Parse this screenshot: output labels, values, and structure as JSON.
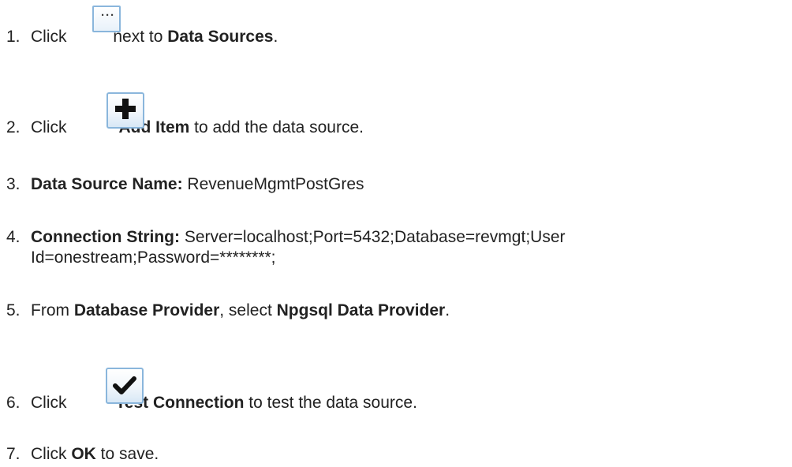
{
  "steps": [
    {
      "num": "1.",
      "pre": "Click",
      "post": " next to ",
      "bold": "Data Sources",
      "end": "."
    },
    {
      "num": "2.",
      "pre": "Click",
      "bold": "Add Item",
      "post": " to add the data source."
    },
    {
      "num": "3.",
      "bold": "Data Source Name:",
      "value": " RevenueMgmtPostGres"
    },
    {
      "num": "4.",
      "bold": "Connection String:",
      "value": " Server=localhost;Port=5432;Database=revmgt;User",
      "value_line2": "Id=onestream;Password=********;"
    },
    {
      "num": "5.",
      "pre": "From ",
      "bold": "Database Provider",
      "mid": ", select ",
      "bold2": "Npgsql Data Provider",
      "end": "."
    },
    {
      "num": "6.",
      "pre": "Click",
      "bold": "Test Connection",
      "post": " to test the data source."
    },
    {
      "num": "7.",
      "pre": "Click ",
      "bold": "OK",
      "post": " to save."
    }
  ],
  "icons": {
    "ellipsis_glyph": "···",
    "accent_border": "#8ab6dc",
    "glyph_color": "#111111"
  }
}
